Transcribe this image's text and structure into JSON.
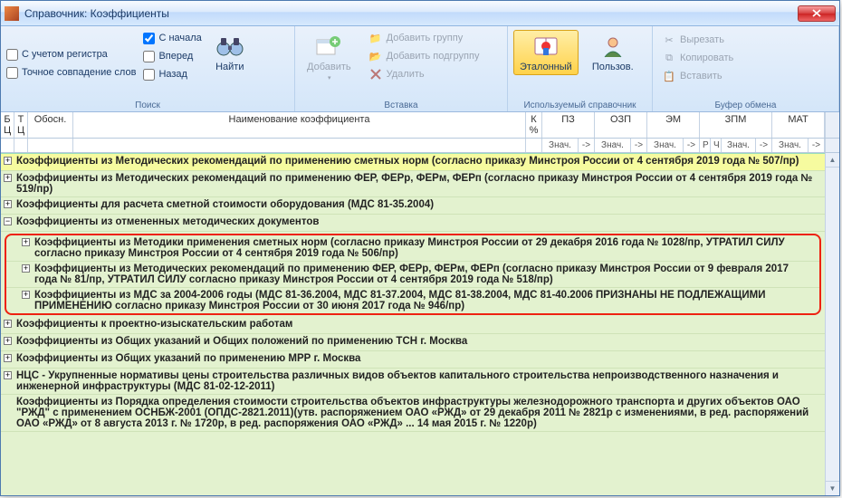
{
  "window_title": "Справочник: Коэффициенты",
  "ribbon": {
    "search": {
      "chk_case": "С учетом регистра",
      "chk_exact": "Точное совпадение слов",
      "chk_start": "С начала",
      "chk_fwd": "Вперед",
      "chk_back": "Назад",
      "find": "Найти",
      "label": "Поиск"
    },
    "insert": {
      "add": "Добавить",
      "add_group": "Добавить группу",
      "add_subgroup": "Добавить подгруппу",
      "delete": "Удалить",
      "label": "Вставка"
    },
    "refbook": {
      "reference": "Эталонный",
      "user": "Пользов.",
      "label": "Используемый справочник"
    },
    "clipboard": {
      "cut": "Вырезать",
      "copy": "Копировать",
      "paste": "Вставить",
      "label": "Буфер обмена"
    }
  },
  "columns": {
    "bc": "Б\nЦ",
    "tc": "Т\nЦ",
    "obо": "Обосн.",
    "name": "Наименование коэффициента",
    "k": "К\n%",
    "pz": "ПЗ",
    "ozp": "ОЗП",
    "em": "ЭМ",
    "zpm": "ЗПМ",
    "mat": "МАТ",
    "znach": "Знач.",
    "arrow": "->",
    "r": "Р",
    "ch": "Ч"
  },
  "rows": [
    "Коэффициенты из Методических рекомендаций по применению сметных норм (согласно приказу Минстроя России от 4 сентября 2019 года № 507/пр)",
    "Коэффициенты из Методических рекомендаций по применению ФЕР, ФЕРр, ФЕРм, ФЕРп (согласно приказу Минстроя России от 4 сентября 2019 года № 519/пр)",
    "Коэффициенты для расчета сметной стоимости оборудования (МДС 81-35.2004)",
    "Коэффициенты из отмененных методических документов",
    "Коэффициенты из Методики применения сметных норм (согласно приказу Минстроя России от 29 декабря 2016 года № 1028/пр, УТРАТИЛ СИЛУ согласно приказу Минстроя России от 4 сентября 2019 года № 506/пр)",
    "Коэффициенты из Методических рекомендаций по применению ФЕР, ФЕРр, ФЕРм, ФЕРп (согласно приказу Минстроя России от 9 февраля 2017 года № 81/пр, УТРАТИЛ СИЛУ согласно приказу Минстроя России от 4 сентября 2019 года № 518/пр)",
    "Коэффициенты из МДС за 2004-2006 годы (МДС 81-36.2004, МДС 81-37.2004, МДС 81-38.2004, МДС 81-40.2006 ПРИЗНАНЫ НЕ ПОДЛЕЖАЩИМИ ПРИМЕНЕНИЮ согласно приказу Минстроя России от 30 июня 2017 года № 946/пр)",
    "Коэффициенты к проектно-изыскательским работам",
    "Коэффициенты из Общих указаний и Общих положений по применению ТСН г. Москва",
    "Коэффициенты из Общих указаний по применению МРР г. Москва",
    "НЦС - Укрупненные нормативы цены строительства различных видов объектов капитального строительства непроизводственного назначения и инженерной инфраструктуры (МДС 81-02-12-2011)",
    "Коэффициенты из Порядка определения стоимости строительства объектов инфраструктуры железнодорожного транспорта и других объектов ОАО \"РЖД\" с применением ОСНБЖ-2001 (ОПДС-2821.2011)(утв. распоряжением ОАО «РЖД» от 29 декабря 2011 № 2821р с изменениями, в ред. распоряжений ОАО «РЖД» от 8 августа 2013 г. № 1720р, в ред. распоряжения ОАО «РЖД» ... 14 мая 2015 г. № 1220р)"
  ]
}
